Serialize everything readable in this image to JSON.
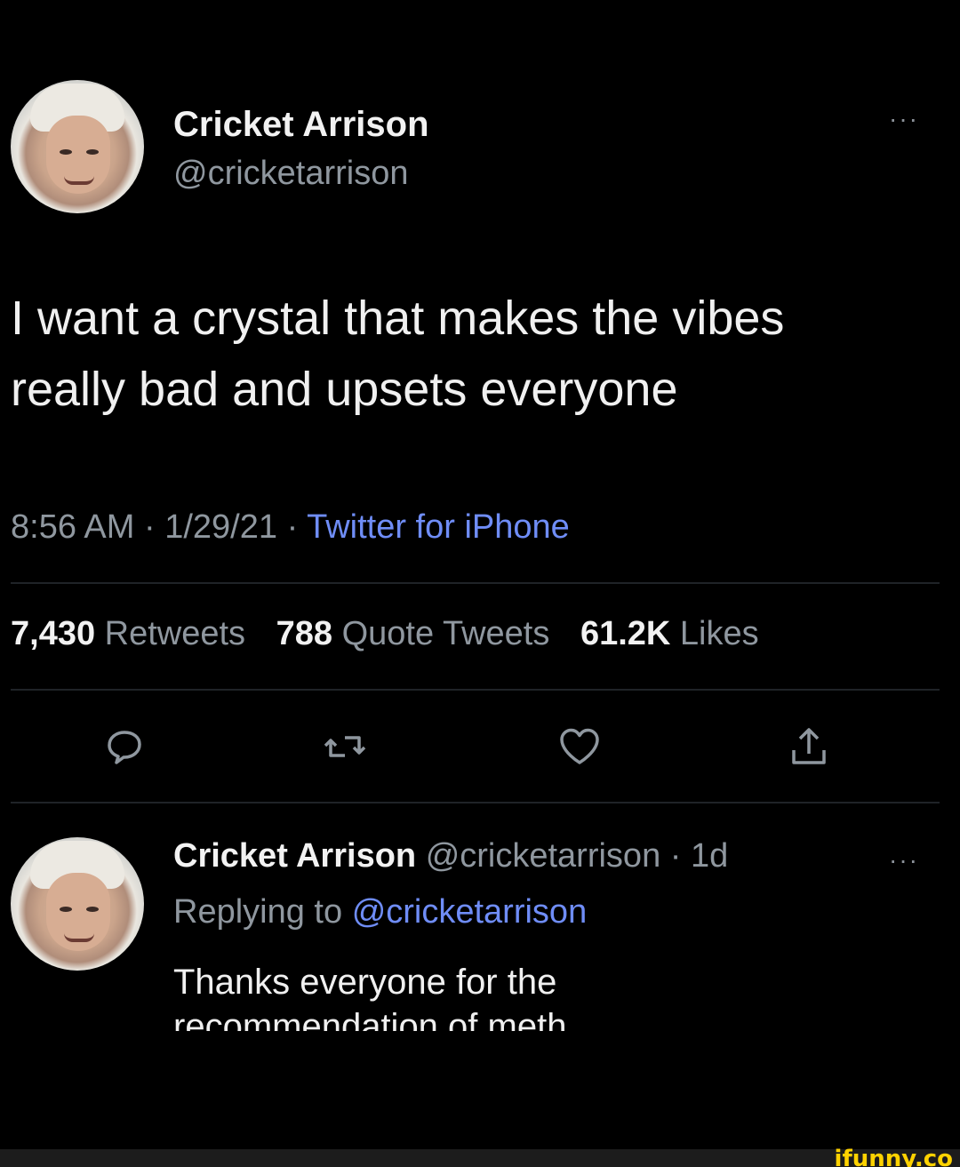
{
  "tweet": {
    "display_name": "Cricket Arrison",
    "handle": "@cricketarrison",
    "more": "···",
    "text_line1": "I want a crystal that makes the vibes",
    "text_line2": "really bad and upsets everyone",
    "time": "8:56 AM",
    "separator": "·",
    "date": "1/29/21",
    "source": "Twitter for iPhone",
    "stats": {
      "retweets_count": "7,430",
      "retweets_label": "Retweets",
      "quotes_count": "788",
      "quotes_label": "Quote Tweets",
      "likes_count": "61.2K",
      "likes_label": "Likes"
    },
    "actions": [
      "reply-icon",
      "retweet-icon",
      "like-icon",
      "share-icon"
    ]
  },
  "reply": {
    "display_name": "Cricket Arrison",
    "handle_time": "@cricketarrison · 1d",
    "more": "···",
    "replying_prefix": "Replying to",
    "replying_mention": "@cricketarrison",
    "text_line1": "Thanks everyone for the",
    "text_line2": "recommendation of meth"
  },
  "watermark": "ifunny.co",
  "colors": {
    "background": "#000000",
    "link": "#6f8df7",
    "muted": "#8f979f",
    "watermark": "#ffd200"
  }
}
